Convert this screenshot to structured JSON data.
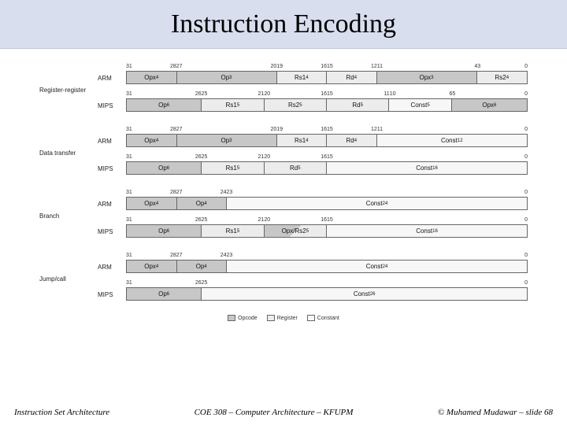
{
  "title": "Instruction Encoding",
  "legend": {
    "opcode": "Opcode",
    "register": "Register",
    "constant": "Constant"
  },
  "footer": {
    "left": "Instruction Set Architecture",
    "center": "COE 308 – Computer Architecture – KFUPM",
    "right": "© Muhamed Mudawar – slide 68"
  },
  "chart_data": {
    "type": "table",
    "groups": [
      {
        "label": "Register-register",
        "rows": [
          {
            "arch": "ARM",
            "bits": [
              31,
              28,
              27,
              20,
              19,
              16,
              15,
              12,
              11,
              4,
              3,
              0
            ],
            "fields": [
              {
                "label": "Opx",
                "sup": "4",
                "type": "op",
                "w": 4
              },
              {
                "label": "Op",
                "sup": "3",
                "type": "op",
                "w": 8
              },
              {
                "label": "Rs1",
                "sup": "4",
                "type": "reg",
                "w": 4
              },
              {
                "label": "Rd",
                "sup": "4",
                "type": "reg",
                "w": 4
              },
              {
                "label": "Opx",
                "sup": "3",
                "type": "op",
                "w": 8
              },
              {
                "label": "Rs2",
                "sup": "4",
                "type": "reg",
                "w": 4
              }
            ]
          },
          {
            "arch": "MIPS",
            "bits": [
              31,
              26,
              25,
              21,
              20,
              16,
              15,
              11,
              10,
              6,
              5,
              0
            ],
            "fields": [
              {
                "label": "Op",
                "sup": "6",
                "type": "op",
                "w": 6
              },
              {
                "label": "Rs1",
                "sup": "5",
                "type": "reg",
                "w": 5
              },
              {
                "label": "Rs2",
                "sup": "5",
                "type": "reg",
                "w": 5
              },
              {
                "label": "Rd",
                "sup": "5",
                "type": "reg",
                "w": 5
              },
              {
                "label": "Const",
                "sup": "5",
                "type": "con",
                "w": 5
              },
              {
                "label": "Opx",
                "sup": "6",
                "type": "op",
                "w": 6
              }
            ]
          }
        ]
      },
      {
        "label": "Data transfer",
        "rows": [
          {
            "arch": "ARM",
            "bits": [
              31,
              28,
              27,
              20,
              19,
              16,
              15,
              12,
              11,
              0
            ],
            "fields": [
              {
                "label": "Opx",
                "sup": "4",
                "type": "op",
                "w": 4
              },
              {
                "label": "Op",
                "sup": "3",
                "type": "op",
                "w": 8
              },
              {
                "label": "Rs1",
                "sup": "4",
                "type": "reg",
                "w": 4
              },
              {
                "label": "Rd",
                "sup": "4",
                "type": "reg",
                "w": 4
              },
              {
                "label": "Const",
                "sup": "12",
                "type": "con",
                "w": 12
              }
            ]
          },
          {
            "arch": "MIPS",
            "bits": [
              31,
              26,
              25,
              21,
              20,
              16,
              15,
              0
            ],
            "fields": [
              {
                "label": "Op",
                "sup": "6",
                "type": "op",
                "w": 6
              },
              {
                "label": "Rs1",
                "sup": "5",
                "type": "reg",
                "w": 5
              },
              {
                "label": "Rd",
                "sup": "5",
                "type": "reg",
                "w": 5
              },
              {
                "label": "Const",
                "sup": "16",
                "type": "con",
                "w": 16
              }
            ]
          }
        ]
      },
      {
        "label": "Branch",
        "rows": [
          {
            "arch": "ARM",
            "bits": [
              31,
              28,
              27,
              24,
              23,
              0
            ],
            "fields": [
              {
                "label": "Opx",
                "sup": "4",
                "type": "op",
                "w": 4
              },
              {
                "label": "Op",
                "sup": "4",
                "type": "op",
                "w": 4
              },
              {
                "label": "Const",
                "sup": "24",
                "type": "con",
                "w": 24
              }
            ]
          },
          {
            "arch": "MIPS",
            "bits": [
              31,
              26,
              25,
              21,
              20,
              16,
              15,
              0
            ],
            "fields": [
              {
                "label": "Op",
                "sup": "6",
                "type": "op",
                "w": 6
              },
              {
                "label": "Rs1",
                "sup": "5",
                "type": "reg",
                "w": 5
              },
              {
                "label": "Opx/Rs2",
                "sup": "5",
                "type": "split",
                "w": 5
              },
              {
                "label": "Const",
                "sup": "16",
                "type": "con",
                "w": 16
              }
            ]
          }
        ]
      },
      {
        "label": "Jump/call",
        "rows": [
          {
            "arch": "ARM",
            "bits": [
              31,
              28,
              27,
              24,
              23,
              0
            ],
            "fields": [
              {
                "label": "Opx",
                "sup": "4",
                "type": "op",
                "w": 4
              },
              {
                "label": "Op",
                "sup": "4",
                "type": "op",
                "w": 4
              },
              {
                "label": "Const",
                "sup": "24",
                "type": "con",
                "w": 24
              }
            ]
          },
          {
            "arch": "MIPS",
            "bits": [
              31,
              26,
              25,
              0
            ],
            "fields": [
              {
                "label": "Op",
                "sup": "6",
                "type": "op",
                "w": 6
              },
              {
                "label": "Const",
                "sup": "26",
                "type": "con",
                "w": 26
              }
            ]
          }
        ]
      }
    ]
  }
}
